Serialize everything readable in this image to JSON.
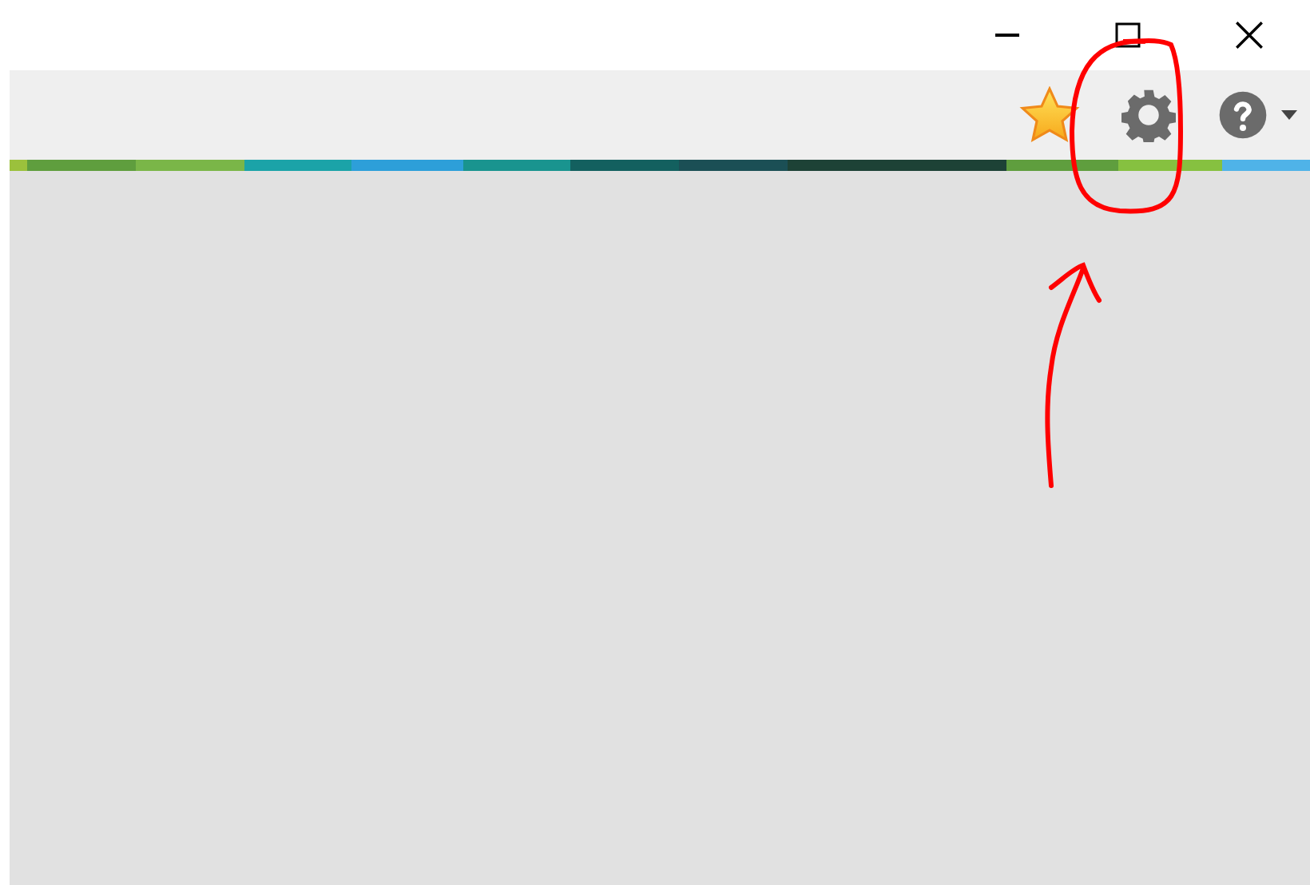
{
  "window_controls": [
    {
      "kind": "minimize"
    },
    {
      "kind": "maximize"
    },
    {
      "kind": "close"
    }
  ],
  "toolbar": [
    {
      "kind": "favorites"
    },
    {
      "kind": "settings"
    },
    {
      "kind": "help"
    }
  ],
  "stripe": [
    {
      "color": "#9bc13c"
    },
    {
      "color": "#5f9e3e"
    },
    {
      "color": "#7ab648"
    },
    {
      "color": "#1ba3a8"
    },
    {
      "color": "#2d9fd9"
    },
    {
      "color": "#19948f"
    },
    {
      "color": "#13605f"
    },
    {
      "color": "#1b4f55"
    },
    {
      "color": "#1d4236"
    },
    {
      "color": "#1d4236"
    },
    {
      "color": "#5f9e3e"
    },
    {
      "color": "#86c140"
    },
    {
      "color": "#4fb3e8"
    }
  ]
}
